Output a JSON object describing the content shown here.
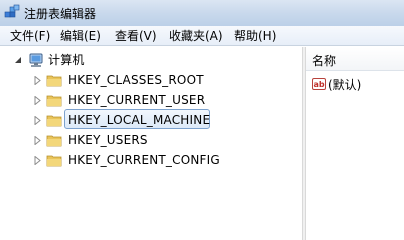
{
  "window": {
    "title": "注册表编辑器"
  },
  "menu": {
    "items": [
      {
        "label": "文件(F)"
      },
      {
        "label": "编辑(E)"
      },
      {
        "label": "查看(V)"
      },
      {
        "label": "收藏夹(A)"
      },
      {
        "label": "帮助(H)"
      }
    ]
  },
  "tree": {
    "root": {
      "label": "计算机",
      "expanded": true
    },
    "keys": [
      {
        "label": "HKEY_CLASSES_ROOT"
      },
      {
        "label": "HKEY_CURRENT_USER"
      },
      {
        "label": "HKEY_LOCAL_MACHINE",
        "selected": true
      },
      {
        "label": "HKEY_USERS"
      },
      {
        "label": "HKEY_CURRENT_CONFIG"
      }
    ]
  },
  "list": {
    "column_header": "名称",
    "values": [
      {
        "name": "(默认)",
        "icon": "string-value-icon"
      }
    ]
  },
  "colors": {
    "selection_border": "#7da2ce",
    "folder": "#e9c45a"
  }
}
